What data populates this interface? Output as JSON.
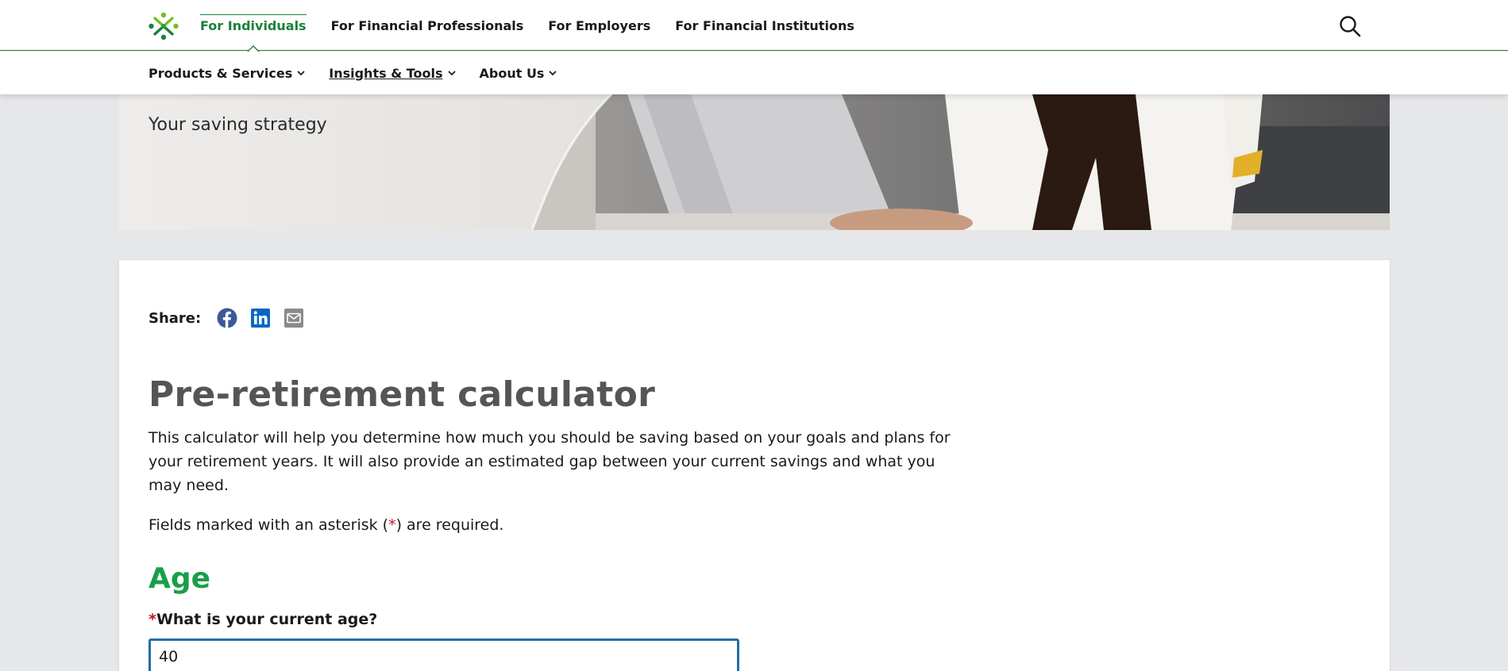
{
  "topnav": {
    "items": [
      {
        "label": "For Individuals",
        "active": true
      },
      {
        "label": "For Financial Professionals"
      },
      {
        "label": "For Employers"
      },
      {
        "label": "For Financial Institutions"
      }
    ],
    "search_icon": "search-icon",
    "logo_icon": "brand-logo"
  },
  "subnav": {
    "items": [
      {
        "label": "Products & Services"
      },
      {
        "label": "Insights & Tools"
      },
      {
        "label": "About Us"
      }
    ]
  },
  "hero": {
    "subtitle": "Your saving strategy"
  },
  "share": {
    "label": "Share:",
    "icons": [
      "facebook-icon",
      "linkedin-icon",
      "email-icon"
    ]
  },
  "page": {
    "title": "Pre-retirement calculator",
    "intro": "This calculator will help you determine how much you should be saving based on your goals and plans for your retirement years. It will also provide an estimated gap between your current savings and what you may need.",
    "required_prefix": "Fields marked with an asterisk (",
    "required_star": "*",
    "required_suffix": ") are required."
  },
  "age_section": {
    "heading": "Age",
    "star": "*",
    "question": "What is your current age?",
    "value": "40"
  },
  "colors": {
    "brand_green": "#1a9e48",
    "active_nav": "#19813a",
    "input_focus": "#1f6fa8",
    "required_star": "#c8102e",
    "facebook": "#3b5998",
    "linkedin": "#0a66c2"
  }
}
